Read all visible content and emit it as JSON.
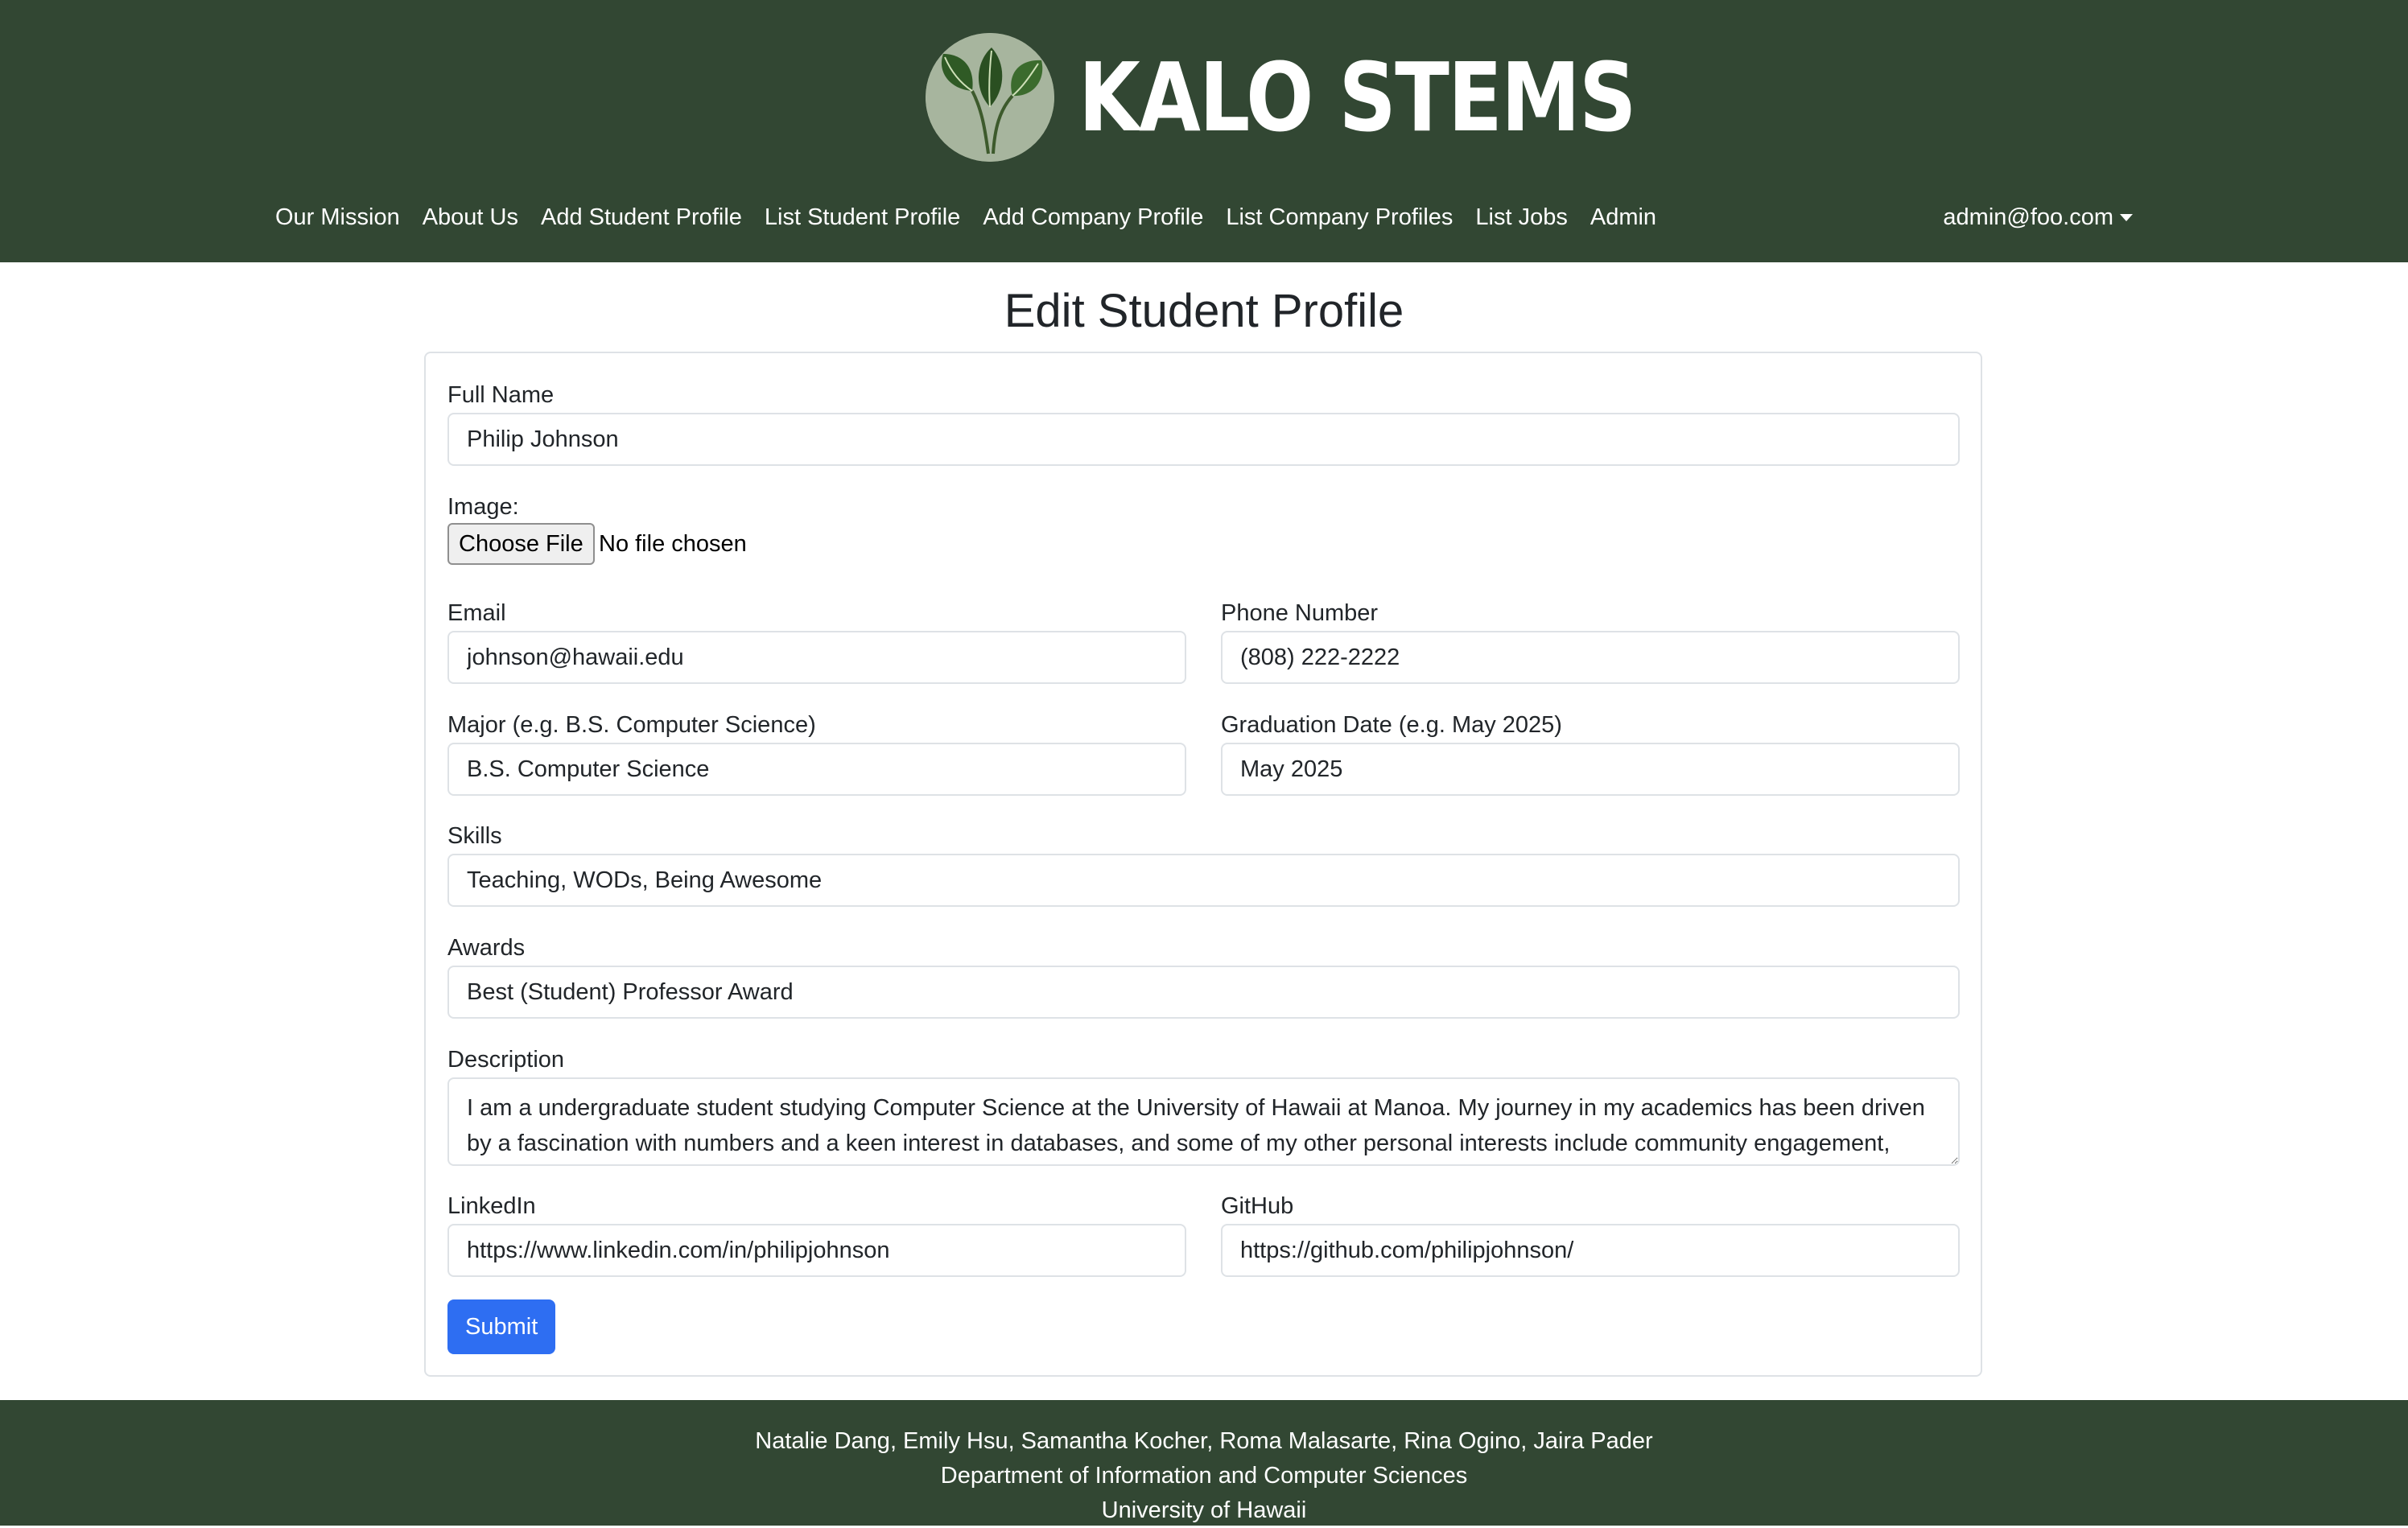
{
  "brand": {
    "name": "KALO STEMS"
  },
  "nav": {
    "items": [
      "Our Mission",
      "About Us",
      "Add Student Profile",
      "List Student Profile",
      "Add Company Profile",
      "List Company Profiles",
      "List Jobs",
      "Admin"
    ],
    "user": "admin@foo.com"
  },
  "page": {
    "title": "Edit Student Profile"
  },
  "form": {
    "full_name": {
      "label": "Full Name",
      "value": "Philip Johnson"
    },
    "image": {
      "label": "Image:",
      "button": "Choose File",
      "status": "No file chosen"
    },
    "email": {
      "label": "Email",
      "value": "johnson@hawaii.edu"
    },
    "phone": {
      "label": "Phone Number",
      "value": "(808) 222-2222"
    },
    "major": {
      "label": "Major (e.g. B.S. Computer Science)",
      "value": "B.S. Computer Science"
    },
    "graduation": {
      "label": "Graduation Date (e.g. May 2025)",
      "value": "May 2025"
    },
    "skills": {
      "label": "Skills",
      "value": "Teaching, WODs, Being Awesome"
    },
    "awards": {
      "label": "Awards",
      "value": "Best (Student) Professor Award"
    },
    "description": {
      "label": "Description",
      "value": "I am a undergraduate student studying Computer Science at the University of Hawaii at Manoa. My journey in my academics has been driven by a fascination with numbers and a keen interest in databases, and some of my other personal interests include community engagement,"
    },
    "linkedin": {
      "label": "LinkedIn",
      "value": "https://www.linkedin.com/in/philipjohnson"
    },
    "github": {
      "label": "GitHub",
      "value": "https://github.com/philipjohnson/"
    },
    "submit": "Submit"
  },
  "footer": {
    "line1": "Natalie Dang, Emily Hsu, Samantha Kocher, Roma Malasarte, Rina Ogino, Jaira Pader",
    "line2": "Department of Information and Computer Sciences",
    "line3": "University of Hawaii"
  },
  "colors": {
    "header_bg": "#324733",
    "primary": "#2e6ef2"
  },
  "icons": {
    "logo": "taro-leaf-logo",
    "dropdown": "caret-down-icon"
  }
}
